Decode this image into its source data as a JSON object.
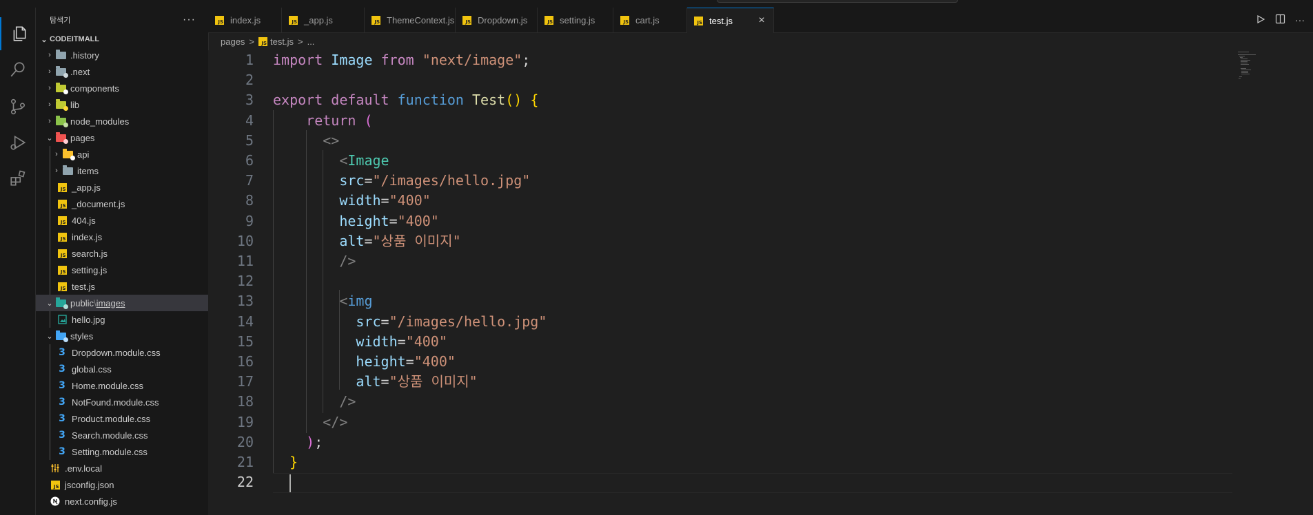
{
  "sidebar": {
    "title": "탐색기",
    "more": "···",
    "root": "CODEITMALL",
    "tree": [
      {
        "label": ".history",
        "depth": 0,
        "type": "folder",
        "chevron": "›",
        "color": "#90a4ae"
      },
      {
        "label": ".next",
        "depth": 0,
        "type": "folder",
        "chevron": "›",
        "color": "#90a4ae",
        "badge": "#cfd8dc"
      },
      {
        "label": "components",
        "depth": 0,
        "type": "folder",
        "chevron": "›",
        "color": "#c0ca33",
        "badge": "#ffffff"
      },
      {
        "label": "lib",
        "depth": 0,
        "type": "folder",
        "chevron": "›",
        "color": "#c0ca33",
        "badge": "#fdd835"
      },
      {
        "label": "node_modules",
        "depth": 0,
        "type": "folder",
        "chevron": "›",
        "color": "#8bc34a",
        "badge": "#c5e1a5"
      },
      {
        "label": "pages",
        "depth": 0,
        "type": "folder",
        "chevron": "⌄",
        "color": "#ef5350",
        "badge": "#ffcdd2"
      },
      {
        "label": "api",
        "depth": 1,
        "type": "folder",
        "chevron": "›",
        "color": "#fbc02d",
        "badge": "#ffffff"
      },
      {
        "label": "items",
        "depth": 1,
        "type": "folder",
        "chevron": "›",
        "color": "#90a4ae"
      },
      {
        "label": "_app.js",
        "depth": 1,
        "type": "js"
      },
      {
        "label": "_document.js",
        "depth": 1,
        "type": "js"
      },
      {
        "label": "404.js",
        "depth": 1,
        "type": "js"
      },
      {
        "label": "index.js",
        "depth": 1,
        "type": "js"
      },
      {
        "label": "search.js",
        "depth": 1,
        "type": "js"
      },
      {
        "label": "setting.js",
        "depth": 1,
        "type": "js"
      },
      {
        "label": "test.js",
        "depth": 1,
        "type": "js"
      },
      {
        "label": "public",
        "label2": "images",
        "depth": 0,
        "type": "folder",
        "chevron": "⌄",
        "color": "#26a69a",
        "badge": "#b2dfdb",
        "selected": true
      },
      {
        "label": "hello.jpg",
        "depth": 1,
        "type": "img"
      },
      {
        "label": "styles",
        "depth": 0,
        "type": "folder",
        "chevron": "⌄",
        "color": "#42a5f5",
        "badge": "#bbdefb"
      },
      {
        "label": "Dropdown.module.css",
        "depth": 1,
        "type": "css"
      },
      {
        "label": "global.css",
        "depth": 1,
        "type": "css"
      },
      {
        "label": "Home.module.css",
        "depth": 1,
        "type": "css"
      },
      {
        "label": "NotFound.module.css",
        "depth": 1,
        "type": "css"
      },
      {
        "label": "Product.module.css",
        "depth": 1,
        "type": "css"
      },
      {
        "label": "Search.module.css",
        "depth": 1,
        "type": "css"
      },
      {
        "label": "Setting.module.css",
        "depth": 1,
        "type": "css"
      },
      {
        "label": ".env.local",
        "depth": 0,
        "type": "env"
      },
      {
        "label": "jsconfig.json",
        "depth": 0,
        "type": "js"
      },
      {
        "label": "next.config.js",
        "depth": 0,
        "type": "next"
      }
    ]
  },
  "tabs": [
    {
      "label": "index.js",
      "active": false
    },
    {
      "label": "_app.js",
      "active": false
    },
    {
      "label": "ThemeContext.js",
      "active": false
    },
    {
      "label": "Dropdown.js",
      "active": false
    },
    {
      "label": "setting.js",
      "active": false
    },
    {
      "label": "cart.js",
      "active": false
    },
    {
      "label": "test.js",
      "active": true
    }
  ],
  "tab_close": "×",
  "breadcrumb": {
    "folder": "pages",
    "sep": ">",
    "file": "test.js",
    "sep2": ">",
    "more": "..."
  },
  "icons": {
    "explorer": "explorer-icon",
    "search": "search-icon",
    "scm": "source-control-icon",
    "debug": "run-debug-icon",
    "extensions": "extensions-icon",
    "run": "run-icon",
    "split": "split-editor-icon",
    "more": "more-actions-icon"
  },
  "colors": {
    "accent": "#0078d4",
    "keyword": "#c586c0",
    "string": "#ce9178",
    "attr": "#9cdcfe",
    "component": "#4ec9b0"
  },
  "code": {
    "current_line": 22,
    "lines": [
      {
        "n": "1",
        "t": [
          [
            "k",
            "import"
          ],
          [
            "w",
            " "
          ],
          [
            "a",
            "Image"
          ],
          [
            "w",
            " "
          ],
          [
            "k",
            "from"
          ],
          [
            "w",
            " "
          ],
          [
            "s",
            "\"next/image\""
          ],
          [
            "w",
            ";"
          ]
        ]
      },
      {
        "n": "2",
        "t": []
      },
      {
        "n": "3",
        "t": [
          [
            "k",
            "export"
          ],
          [
            "w",
            " "
          ],
          [
            "k",
            "default"
          ],
          [
            "w",
            " "
          ],
          [
            "b",
            "function"
          ],
          [
            "w",
            " "
          ],
          [
            "f",
            "Test"
          ],
          [
            "y",
            "()"
          ],
          [
            "w",
            " "
          ],
          [
            "y",
            "{"
          ]
        ]
      },
      {
        "n": "4",
        "t": [
          [
            "w",
            "    "
          ],
          [
            "k",
            "return"
          ],
          [
            "w",
            " "
          ],
          [
            "p",
            "("
          ]
        ]
      },
      {
        "n": "5",
        "t": [
          [
            "w",
            "      "
          ],
          [
            "g",
            "<>"
          ]
        ]
      },
      {
        "n": "6",
        "t": [
          [
            "w",
            "        "
          ],
          [
            "g",
            "<"
          ],
          [
            "c",
            "Image"
          ]
        ]
      },
      {
        "n": "7",
        "t": [
          [
            "w",
            "        "
          ],
          [
            "a",
            "src"
          ],
          [
            "w",
            "="
          ],
          [
            "s",
            "\"/images/hello.jpg\""
          ]
        ]
      },
      {
        "n": "8",
        "t": [
          [
            "w",
            "        "
          ],
          [
            "a",
            "width"
          ],
          [
            "w",
            "="
          ],
          [
            "s",
            "\"400\""
          ]
        ]
      },
      {
        "n": "9",
        "t": [
          [
            "w",
            "        "
          ],
          [
            "a",
            "height"
          ],
          [
            "w",
            "="
          ],
          [
            "s",
            "\"400\""
          ]
        ]
      },
      {
        "n": "10",
        "t": [
          [
            "w",
            "        "
          ],
          [
            "a",
            "alt"
          ],
          [
            "w",
            "="
          ],
          [
            "s",
            "\"상품 이미지\""
          ]
        ]
      },
      {
        "n": "11",
        "t": [
          [
            "w",
            "        "
          ],
          [
            "g",
            "/>"
          ]
        ]
      },
      {
        "n": "12",
        "t": []
      },
      {
        "n": "13",
        "t": [
          [
            "w",
            "        "
          ],
          [
            "g",
            "<"
          ],
          [
            "b",
            "img"
          ]
        ]
      },
      {
        "n": "14",
        "t": [
          [
            "w",
            "          "
          ],
          [
            "a",
            "src"
          ],
          [
            "w",
            "="
          ],
          [
            "s",
            "\"/images/hello.jpg\""
          ]
        ]
      },
      {
        "n": "15",
        "t": [
          [
            "w",
            "          "
          ],
          [
            "a",
            "width"
          ],
          [
            "w",
            "="
          ],
          [
            "s",
            "\"400\""
          ]
        ]
      },
      {
        "n": "16",
        "t": [
          [
            "w",
            "          "
          ],
          [
            "a",
            "height"
          ],
          [
            "w",
            "="
          ],
          [
            "s",
            "\"400\""
          ]
        ]
      },
      {
        "n": "17",
        "t": [
          [
            "w",
            "          "
          ],
          [
            "a",
            "alt"
          ],
          [
            "w",
            "="
          ],
          [
            "s",
            "\"상품 이미지\""
          ]
        ]
      },
      {
        "n": "18",
        "t": [
          [
            "w",
            "        "
          ],
          [
            "g",
            "/>"
          ]
        ]
      },
      {
        "n": "19",
        "t": [
          [
            "w",
            "      "
          ],
          [
            "g",
            "</>"
          ]
        ]
      },
      {
        "n": "20",
        "t": [
          [
            "w",
            "    "
          ],
          [
            "p",
            ")"
          ],
          [
            "w",
            ";"
          ]
        ]
      },
      {
        "n": "21",
        "t": [
          [
            "w",
            "  "
          ],
          [
            "y",
            "}"
          ]
        ]
      },
      {
        "n": "22",
        "t": []
      }
    ]
  }
}
